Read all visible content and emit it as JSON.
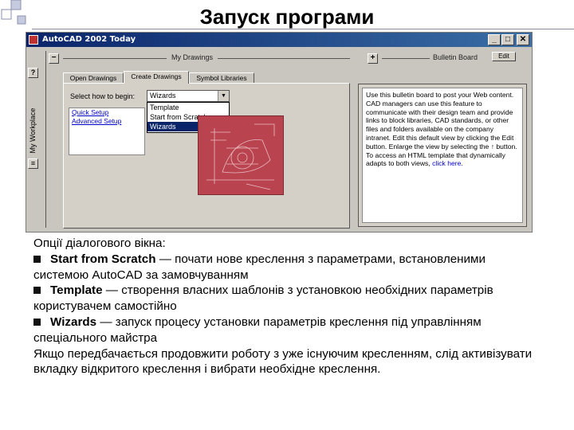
{
  "slide": {
    "title": "Запуск програми"
  },
  "window": {
    "title": "AutoCAD 2002 Today",
    "controls": {
      "minimize": "_",
      "maximize": "□",
      "close": "✕"
    },
    "sidebar_label": "My Workplace",
    "left_panel": {
      "title": "My Drawings",
      "tabs": [
        "Open Drawings",
        "Create Drawings",
        "Symbol Libraries"
      ],
      "active_tab": "Create Drawings",
      "select_label": "Select how to begin:",
      "select_value": "Wizards",
      "dropdown_options": [
        "Template",
        "Start from Scratch",
        "Wizards"
      ],
      "selected_option": "Wizards",
      "wizard_links": [
        "Quick Setup",
        "Advanced Setup"
      ]
    },
    "right_panel": {
      "title": "Bulletin Board",
      "edit_button": "Edit",
      "text": "Use this bulletin board to post your Web content. CAD managers can use this feature to communicate with their design team and provide links to block libraries, CAD standards, or other files and folders available on the company intranet. Edit this default view by clicking the Edit button. Enlarge the view by selecting the ↑ button. To access an HTML template that dynamically adapts to both views,",
      "link_text": "click here."
    }
  },
  "body_text": {
    "intro": "Опції діалогового вікна:",
    "item1_term": "Start from Scratch",
    "item1_text": " — почати нове креслення з параметрами, встановленими системою AutoCAD за замовчуванням",
    "item2_term": "Template",
    "item2_text": " — створення власних шаблонів з установкою необхідних параметрів користувачем самостійно",
    "item3_term": "Wizards",
    "item3_text": " — запуск процесу установки параметрів креслення під управлінням спеціального майстра",
    "closing": "Якщо передбачається продовжити роботу з уже існуючим кресленням, слід активізувати вкладку відкритого креслення і вибрати необхідне креслення."
  }
}
